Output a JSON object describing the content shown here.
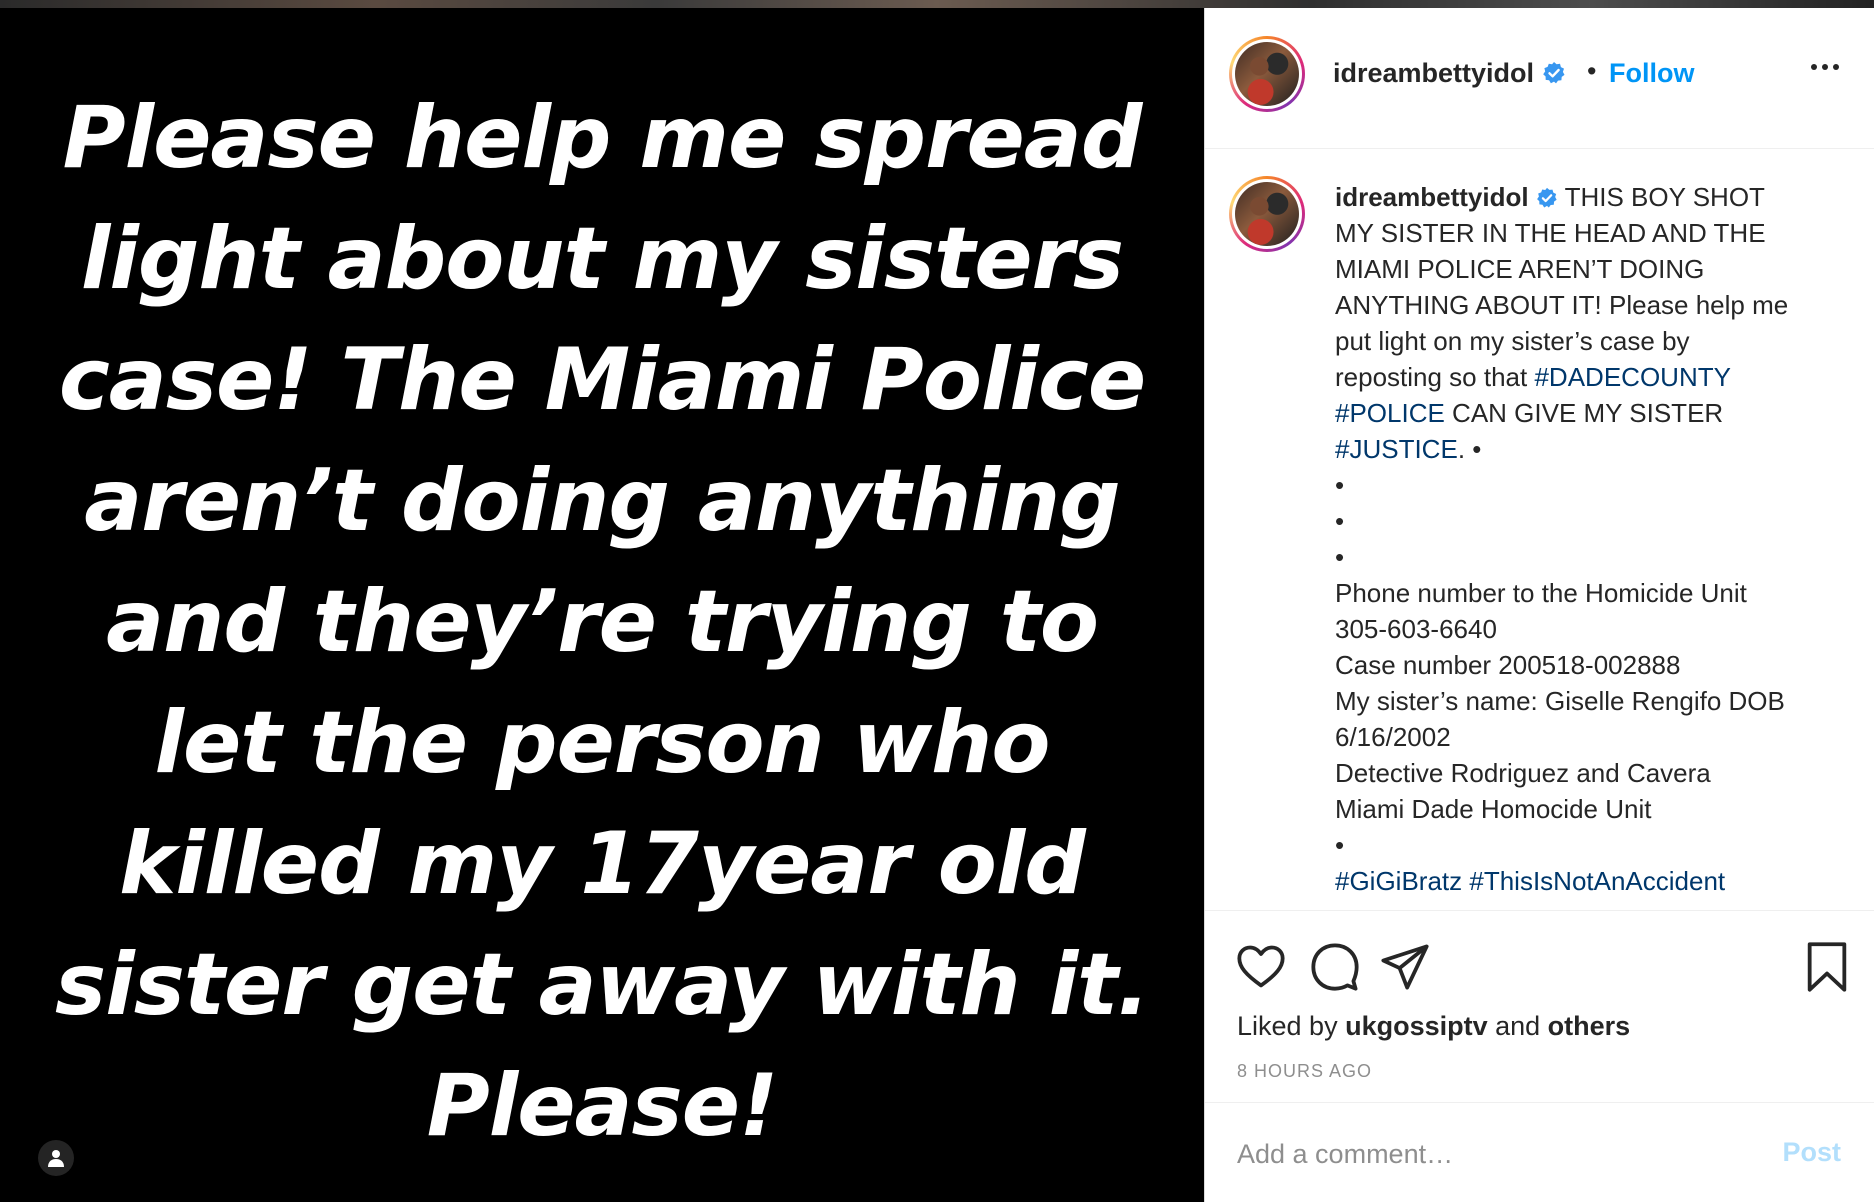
{
  "media": {
    "lines": [
      "Please help me spread",
      "light about my sisters",
      "case! The Miami Police",
      "aren’t doing anything",
      "and they’re trying to",
      "let the person who",
      "killed my 17year old",
      "sister get away with it.",
      "Please!"
    ]
  },
  "header": {
    "username": "idreambettyidol",
    "separator": "•",
    "follow_label": "Follow"
  },
  "caption": {
    "username": "idreambettyidol",
    "text_1": "THIS BOY SHOT",
    "text_2": "MY SISTER IN THE HEAD AND THE",
    "text_3": "MIAMI POLICE AREN’T DOING",
    "text_4": "ANYTHING ABOUT IT! Please help me",
    "text_5": "put light on my sister’s case by",
    "text_6a": "reposting so that ",
    "hashtag_dadecounty": "#DADECOUNTY",
    "hashtag_police": "#POLICE",
    "text_7": " CAN GIVE MY SISTER",
    "hashtag_justice": "#JUSTICE",
    "text_8": ". •",
    "bullet": "•",
    "phone_label": "Phone number to the Homicide Unit",
    "phone_number": "305-603-6640",
    "case_number": "Case number 200518-002888",
    "sister_name": "My sister’s name: Giselle Rengifo DOB",
    "dob": "6/16/2002",
    "detectives": "Detective Rodriguez and Cavera",
    "unit": "Miami Dade Homocide Unit",
    "hashtags_partial": "#GiGiBratz #ThisIsNotAnAccident"
  },
  "actions": {
    "liked_prefix": "Liked by ",
    "liked_user": "ukgossiptv",
    "liked_and": " and ",
    "liked_others": "others",
    "timestamp": "8 HOURS AGO"
  },
  "comment_box": {
    "placeholder": "Add a comment…",
    "post_label": "Post"
  },
  "colors": {
    "follow_blue": "#0095f6",
    "hashtag": "#00376b",
    "verified": "#3897f0",
    "post_disabled": "#b2dffc"
  }
}
